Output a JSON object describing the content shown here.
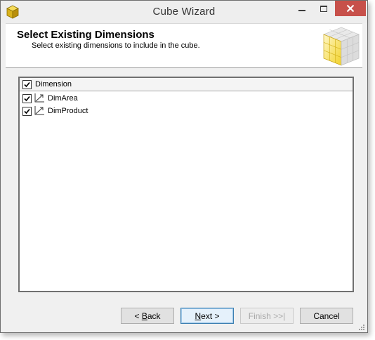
{
  "window": {
    "title": "Cube Wizard"
  },
  "header": {
    "title": "Select Existing Dimensions",
    "subtitle": "Select existing dimensions to include in the cube."
  },
  "grid": {
    "column_header": "Dimension",
    "header_checked": true,
    "rows": [
      {
        "label": "DimArea",
        "checked": true
      },
      {
        "label": "DimProduct",
        "checked": true
      }
    ]
  },
  "buttons": {
    "back": "< Back",
    "next": "Next >",
    "finish": "Finish >>|",
    "cancel": "Cancel"
  },
  "colors": {
    "close_button": "#c7504a",
    "cube_yellow": "#f2d22a",
    "default_button_border": "#3c7fb1"
  }
}
